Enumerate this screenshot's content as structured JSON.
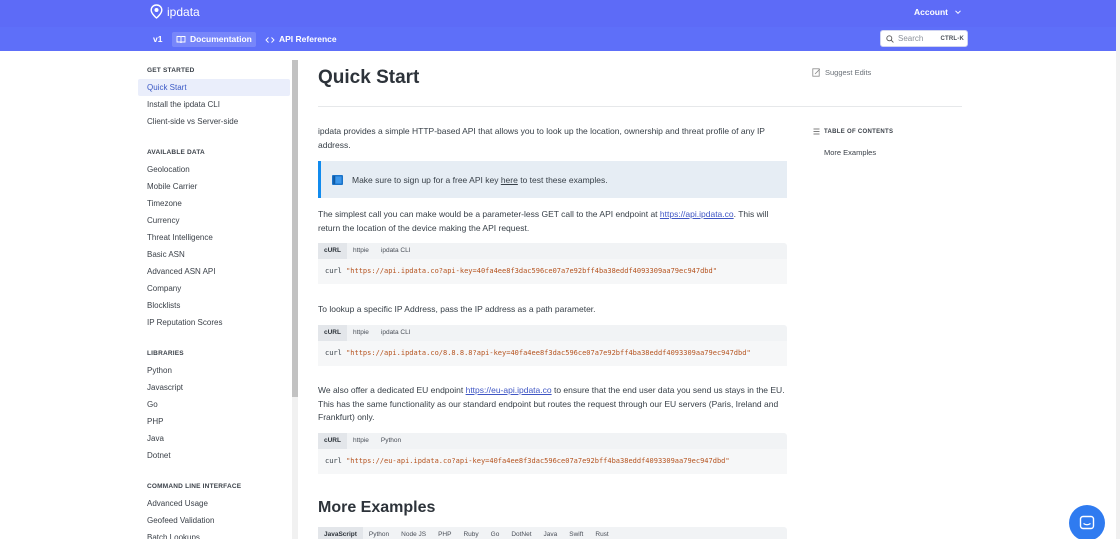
{
  "brand": {
    "name": "ipdata"
  },
  "header": {
    "account_label": "Account",
    "version": "v1",
    "nav": [
      {
        "label": "Documentation",
        "active": true
      },
      {
        "label": "API Reference",
        "active": false
      }
    ],
    "search": {
      "placeholder": "Search",
      "shortcut": "CTRL-K"
    }
  },
  "sidebar": {
    "sections": [
      {
        "title": "GET STARTED",
        "items": [
          "Quick Start",
          "Install the ipdata CLI",
          "Client-side vs Server-side"
        ]
      },
      {
        "title": "AVAILABLE DATA",
        "items": [
          "Geolocation",
          "Mobile Carrier",
          "Timezone",
          "Currency",
          "Threat Intelligence",
          "Basic ASN",
          "Advanced ASN API",
          "Company",
          "Blocklists",
          "IP Reputation Scores"
        ]
      },
      {
        "title": "LIBRARIES",
        "items": [
          "Python",
          "Javascript",
          "Go",
          "PHP",
          "Java",
          "Dotnet"
        ]
      },
      {
        "title": "COMMAND LINE INTERFACE",
        "items": [
          "Advanced Usage",
          "Geofeed Validation",
          "Batch Lookups"
        ]
      }
    ],
    "active_item": "Quick Start"
  },
  "main": {
    "title": "Quick Start",
    "suggest_edits": "Suggest Edits",
    "intro": "ipdata provides a simple HTTP-based API that allows you to look up the location, ownership and threat profile of any IP address.",
    "callout": {
      "before": "Make sure to sign up for a free API key ",
      "link": "here",
      "after": " to test these examples."
    },
    "p1": {
      "before": "The simplest call you can make would be a parameter-less GET call to the API endpoint at ",
      "link": "https://api.ipdata.co",
      "after": ". This will return the location of the device making the API request."
    },
    "code1": {
      "tabs": [
        "cURL",
        "httpie",
        "ipdata CLI"
      ],
      "cmd": "curl ",
      "str": "\"https://api.ipdata.co?api-key=40fa4ee8f3dac596ce07a7e92bff4ba38eddf4093309aa79ec947dbd\""
    },
    "p2": "To lookup a specific IP Address, pass the IP address as a path parameter.",
    "code2": {
      "tabs": [
        "cURL",
        "httpie",
        "ipdata CLI"
      ],
      "cmd": "curl ",
      "str": "\"https://api.ipdata.co/8.8.8.8?api-key=40fa4ee8f3dac596ce07a7e92bff4ba38eddf4093309aa79ec947dbd\""
    },
    "p3": {
      "before": "We also offer a dedicated EU endpoint ",
      "link": "https://eu-api.ipdata.co",
      "after": " to ensure that the end user data you send us stays in the EU. This has the same functionality as our standard endpoint but routes the request through our EU servers (Paris, Ireland and Frankfurt) only."
    },
    "code3": {
      "tabs": [
        "cURL",
        "httpie",
        "Python"
      ],
      "cmd": "curl ",
      "str": "\"https://eu-api.ipdata.co?api-key=40fa4ee8f3dac596ce07a7e92bff4ba38eddf4093309aa79ec947dbd\""
    },
    "more_title": "More Examples",
    "code4": {
      "tabs": [
        "JavaScript",
        "Python",
        "Node JS",
        "PHP",
        "Ruby",
        "Go",
        "DotNet",
        "Java",
        "Swift",
        "Rust"
      ]
    }
  },
  "toc": {
    "title": "TABLE OF CONTENTS",
    "items": [
      "More Examples"
    ]
  },
  "colors": {
    "header": "#5d6bf7",
    "accent": "#118bee",
    "link": "#3f56c4",
    "chat": "#2f7bf0"
  }
}
